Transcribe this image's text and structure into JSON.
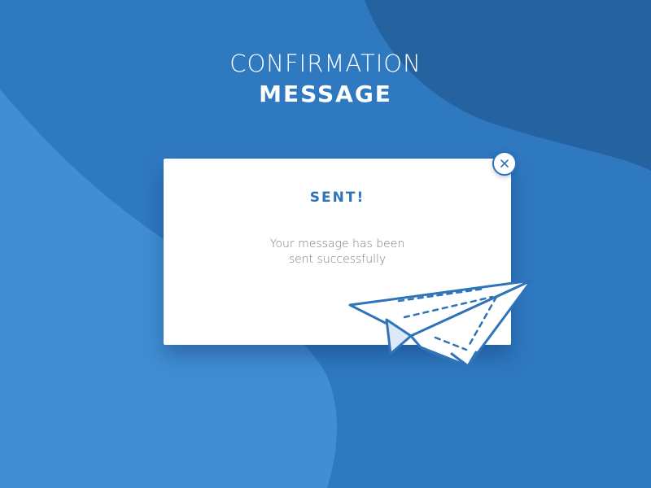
{
  "header": {
    "line1": "CONFIRMATION",
    "line2": "MESSAGE"
  },
  "modal": {
    "title": "SENT!",
    "message_line1": "Your message has been",
    "message_line2": "sent successfully",
    "close_icon": "close-icon",
    "illustration_icon": "paper-plane-icon"
  },
  "colors": {
    "background": "#2f79c1",
    "background_dark": "#2562a0",
    "background_light": "#418ed4",
    "accent": "#2f73b8",
    "card": "#ffffff",
    "message_text": "#7d7d7d"
  }
}
